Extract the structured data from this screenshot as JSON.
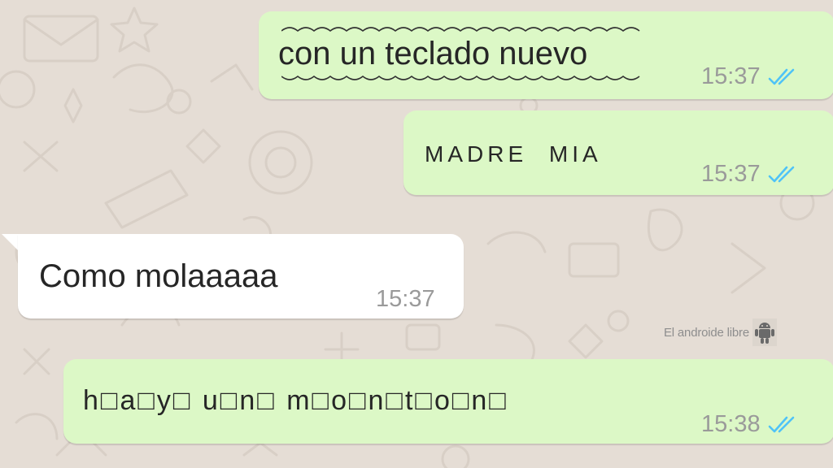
{
  "colors": {
    "wallpaper": "#e5ddd5",
    "outgoing_bubble": "#dcf8c6",
    "incoming_bubble": "#ffffff",
    "read_ticks": "#4fc3f7"
  },
  "messages": [
    {
      "direction": "outgoing",
      "text": "con un teclado nuevo",
      "time": "15:37",
      "status_icon": "double-check-read-icon"
    },
    {
      "direction": "outgoing",
      "text": "MADRE MIA",
      "time": "15:37",
      "status_icon": "double-check-read-icon"
    },
    {
      "direction": "incoming",
      "text": "Como molaaaaa",
      "time": "15:37"
    },
    {
      "direction": "outgoing",
      "text": "h□a□y□ u□n□ m□o□n□t□o□n□",
      "time": "15:38",
      "status_icon": "double-check-read-icon"
    }
  ],
  "watermark": {
    "text": "El androide libre",
    "icon": "android-robot-icon"
  }
}
